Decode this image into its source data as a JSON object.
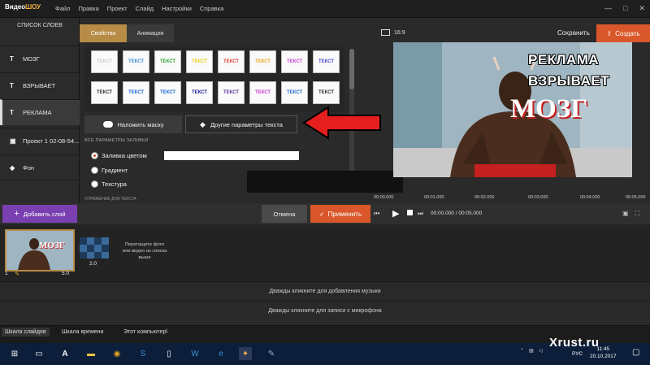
{
  "app": {
    "logo_part1": "Видео",
    "logo_part2": "ШОУ",
    "menu": [
      "Файл",
      "Правка",
      "Проект",
      "Слайд",
      "Настройки",
      "Справка"
    ],
    "window_controls": [
      "—",
      "□",
      "✕"
    ]
  },
  "layers": {
    "title": "СПИСОК СЛОЕВ",
    "items": [
      {
        "icon": "T",
        "label": "МОЗГ"
      },
      {
        "icon": "T",
        "label": "ВЗРЫВАЕТ"
      },
      {
        "icon": "T",
        "label": "РЕКЛАМА"
      },
      {
        "icon": "▣",
        "label": "Проект 1 02-08-54..."
      },
      {
        "icon": "◆",
        "label": "Фон"
      }
    ],
    "selected_index": 2
  },
  "tabs": {
    "properties": "Свойства",
    "animation": "Анимация"
  },
  "presets": {
    "label": "ТЕКСТ",
    "colors": [
      "#cccccc",
      "#3a8fd9",
      "#32a832",
      "#e8d21e",
      "#e5413a",
      "#e8a81e",
      "#c83fd0",
      "#4a4ad8",
      "#333333",
      "#1e6ad0",
      "#1e6ad0",
      "#1e1e9a",
      "#5a3a9a",
      "#c83fd0",
      "#1e6ad0",
      "#333333"
    ]
  },
  "buttons": {
    "mask": "Наложить маску",
    "text_params": "Другие параметры текста",
    "add_layer": "Добавить слой",
    "cancel": "Отмена",
    "apply": "Применить"
  },
  "fill": {
    "section_label": "ВСЕ ПАРАМЕТРЫ ЗАЛИВКИ",
    "options": [
      "Заливка цветом",
      "Градиент",
      "Текстура"
    ],
    "selected": "Заливка цветом",
    "color": "#ffffff",
    "next_section_label": "ОТРАЖЕНИЕ ДЛЯ ТЕКСТА"
  },
  "preview": {
    "aspect": "16:9",
    "save": "Сохранить",
    "create": "Создать",
    "line1": "РЕКЛАМА",
    "line2": "ВЗРЫВАЕТ",
    "line3": "МОЗГ"
  },
  "ruler": [
    "00:00.000",
    "00:01.000",
    "00:02.000",
    "00:03.000",
    "00:04.000",
    "00:05.000"
  ],
  "player": {
    "timecode": "00:00.000 / 00:05.000"
  },
  "slides": {
    "slide1_text": "МОЗГ",
    "slide1_number": "1",
    "slide1_duration": "5.0",
    "transition_duration": "2.0",
    "drop_hint": "Перетащите фото или видео из списка выше"
  },
  "tracks": {
    "music": "Дважды кликните для добавления музыки",
    "mic": "Дважды кликните для записи с микрофона"
  },
  "bottom_tabs": [
    "Шкала слайдов",
    "Шкала времени",
    "Этот компьютер\\"
  ],
  "taskbar": {
    "lang": "РУС",
    "time": "11:45",
    "date": "20.10.2017",
    "watermark": "Xrust.ru"
  },
  "colors": {
    "accent": "#d9572a",
    "tab_active": "#b78c46",
    "add_layer": "#7a3fb0"
  }
}
